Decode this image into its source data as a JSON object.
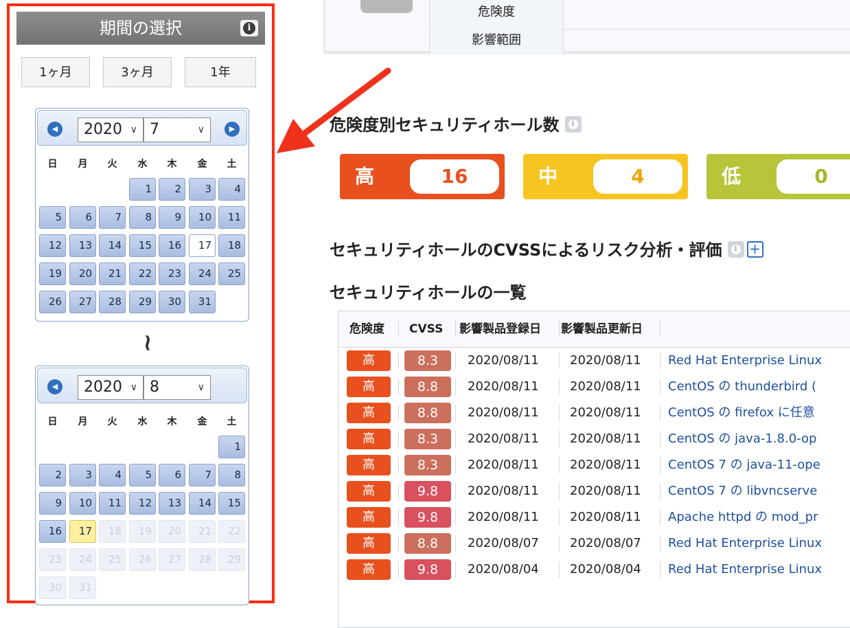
{
  "panel": {
    "title": "期間の選択",
    "info_icon": "i",
    "range_buttons": [
      "1ヶ月",
      "3ヶ月",
      "1年"
    ]
  },
  "calendar_from": {
    "year": "2020",
    "month": "7",
    "weekdays": [
      "日",
      "月",
      "火",
      "水",
      "木",
      "金",
      "土"
    ],
    "days": [
      "1",
      "2",
      "3",
      "4",
      "5",
      "6",
      "7",
      "8",
      "9",
      "10",
      "11",
      "12",
      "13",
      "14",
      "15",
      "16",
      "17",
      "18",
      "19",
      "20",
      "21",
      "22",
      "23",
      "24",
      "25",
      "26",
      "27",
      "28",
      "29",
      "30",
      "31"
    ]
  },
  "calendar_to": {
    "year": "2020",
    "month": "8",
    "weekdays": [
      "日",
      "月",
      "火",
      "水",
      "木",
      "金",
      "土"
    ],
    "days": [
      "1",
      "2",
      "3",
      "4",
      "5",
      "6",
      "7",
      "8",
      "9",
      "10",
      "11",
      "12",
      "13",
      "14",
      "15",
      "16",
      "17",
      "18",
      "19",
      "20",
      "21",
      "22",
      "23",
      "24",
      "25",
      "26",
      "27",
      "28",
      "29",
      "30",
      "31"
    ]
  },
  "range_separator": "~",
  "top_table": {
    "row1_label": "危険度",
    "row2_label": "影響範囲"
  },
  "severity_section": {
    "heading": "危険度別セキュリティホール数",
    "high_label": "高",
    "high_count": "16",
    "mid_label": "中",
    "mid_count": "4",
    "low_label": "低",
    "low_count": "0",
    "colors": {
      "high": "#e8501e",
      "mid": "#f7c522",
      "low": "#b8c53a"
    }
  },
  "cvss_section": {
    "heading": "セキュリティホールのCVSSによるリスク分析・評価",
    "expand_icon": "+"
  },
  "list_section": {
    "heading": "セキュリティホールの一覧",
    "columns": [
      "危険度",
      "CVSS",
      "影響製品登録日",
      "影響製品更新日"
    ],
    "rows": [
      {
        "severity": "高",
        "cvss": "8.3",
        "registered": "2020/08/11",
        "updated": "2020/08/11",
        "title": "Red Hat Enterprise Linux",
        "cvss_color": "#cc6f5c"
      },
      {
        "severity": "高",
        "cvss": "8.8",
        "registered": "2020/08/11",
        "updated": "2020/08/11",
        "title": "CentOS の thunderbird (",
        "cvss_color": "#cc6f5c"
      },
      {
        "severity": "高",
        "cvss": "8.8",
        "registered": "2020/08/11",
        "updated": "2020/08/11",
        "title": "CentOS の firefox に任意",
        "cvss_color": "#cc6f5c"
      },
      {
        "severity": "高",
        "cvss": "8.3",
        "registered": "2020/08/11",
        "updated": "2020/08/11",
        "title": "CentOS の java-1.8.0-op",
        "cvss_color": "#cc6f5c"
      },
      {
        "severity": "高",
        "cvss": "8.3",
        "registered": "2020/08/11",
        "updated": "2020/08/11",
        "title": "CentOS 7 の java-11-ope",
        "cvss_color": "#cc6f5c"
      },
      {
        "severity": "高",
        "cvss": "9.8",
        "registered": "2020/08/11",
        "updated": "2020/08/11",
        "title": "CentOS 7 の libvncserve",
        "cvss_color": "#d9505f"
      },
      {
        "severity": "高",
        "cvss": "9.8",
        "registered": "2020/08/11",
        "updated": "2020/08/11",
        "title": "Apache httpd の mod_pr",
        "cvss_color": "#d9505f"
      },
      {
        "severity": "高",
        "cvss": "8.8",
        "registered": "2020/08/07",
        "updated": "2020/08/07",
        "title": "Red Hat Enterprise Linux",
        "cvss_color": "#cc6f5c"
      },
      {
        "severity": "高",
        "cvss": "9.8",
        "registered": "2020/08/04",
        "updated": "2020/08/04",
        "title": "Red Hat Enterprise Linux",
        "cvss_color": "#d9505f"
      }
    ]
  }
}
